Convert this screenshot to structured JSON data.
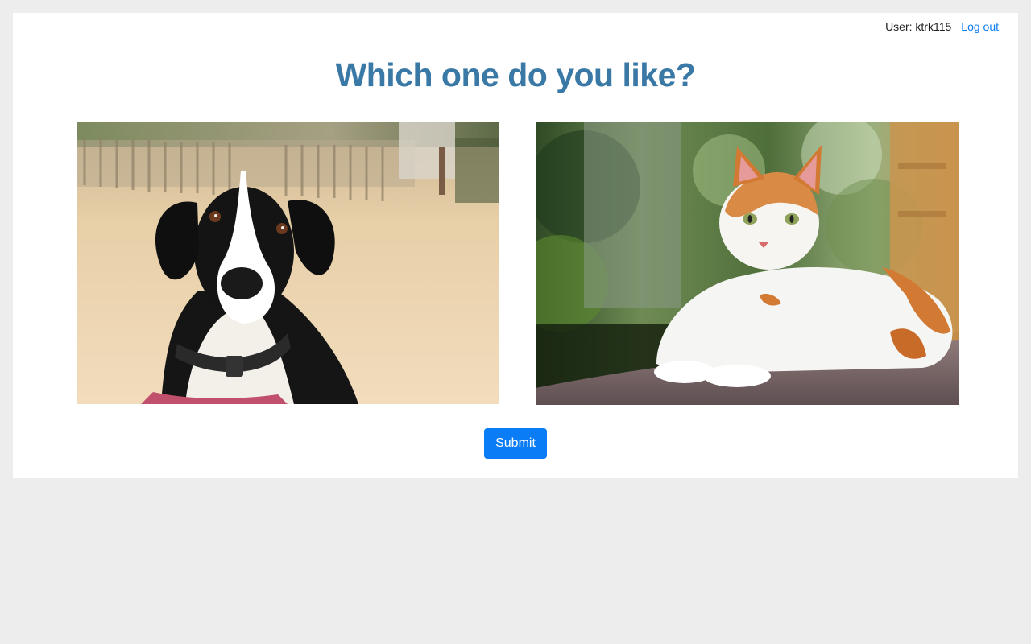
{
  "header": {
    "user_label": "User: ktrk115",
    "logout_label": "Log out"
  },
  "main": {
    "title": "Which one do you like?",
    "options": [
      {
        "subject": "dog"
      },
      {
        "subject": "cat"
      }
    ],
    "submit_label": "Submit"
  },
  "colors": {
    "page_background": "#ededed",
    "card_background": "#ffffff",
    "title": "#3a78a6",
    "link": "#0a7cf5",
    "button": "#0a7cf5"
  }
}
